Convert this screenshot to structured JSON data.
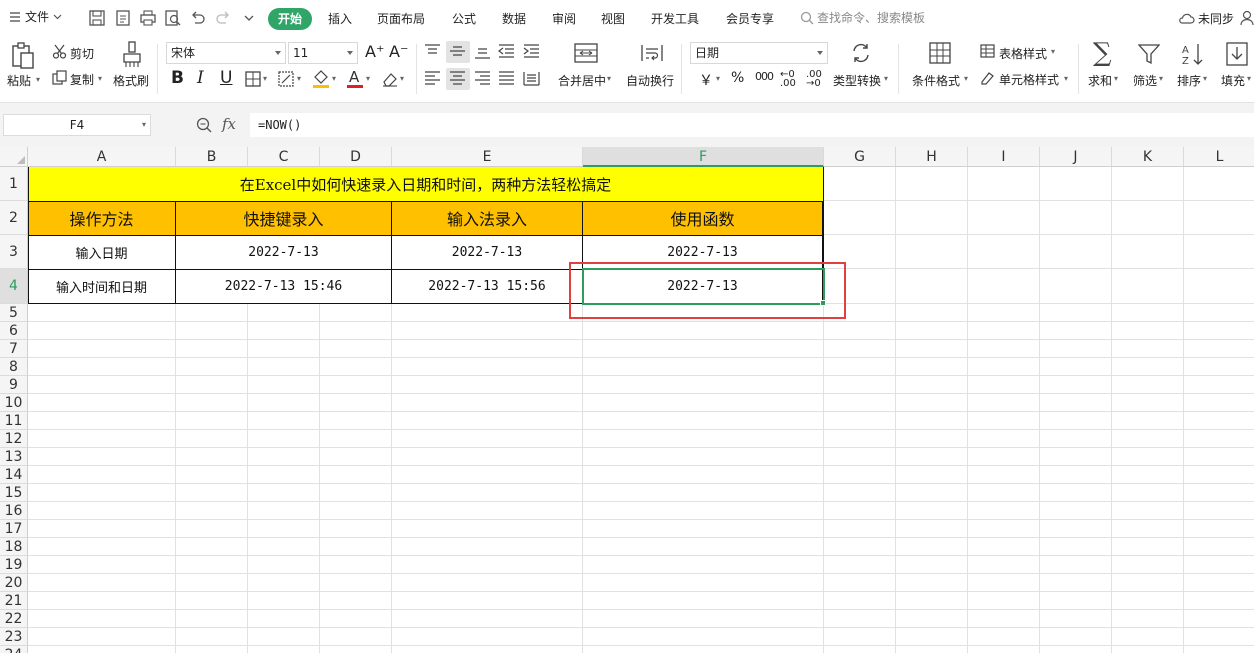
{
  "menu": {
    "file_label": "文件",
    "tabs": [
      "开始",
      "插入",
      "页面布局",
      "公式",
      "数据",
      "审阅",
      "视图",
      "开发工具",
      "会员专享"
    ],
    "search_placeholder": "查找命令、搜索模板",
    "sync_label": "未同步"
  },
  "ribbon": {
    "paste": "粘贴",
    "cut": "剪切",
    "copy": "复制",
    "format_painter": "格式刷",
    "font_name": "宋体",
    "font_size": "11",
    "merge_center": "合并居中",
    "wrap_text": "自动换行",
    "number_format": "日期",
    "currency_symbol": "￥",
    "percent_symbol": "%",
    "thousands_symbol": "000",
    "type_convert": "类型转换",
    "conditional_format": "条件格式",
    "table_style": "表格样式",
    "cell_style": "单元格样式",
    "sum": "求和",
    "filter": "筛选",
    "sort": "排序",
    "fill": "填充"
  },
  "formula_bar": {
    "name_box": "F4",
    "fx": "fx",
    "formula": "=NOW()"
  },
  "columns": [
    "A",
    "B",
    "C",
    "D",
    "E",
    "F",
    "G",
    "H",
    "I",
    "J",
    "K",
    "L"
  ],
  "rows": [
    "1",
    "2",
    "3",
    "4",
    "5",
    "6",
    "7",
    "8",
    "9",
    "10",
    "11",
    "12",
    "13",
    "14",
    "15",
    "16",
    "17",
    "18",
    "19",
    "20",
    "21",
    "22",
    "23",
    "24"
  ],
  "table": {
    "title": "在Excel中如何快速录入日期和时间，两种方法轻松搞定",
    "headers": [
      "操作方法",
      "快捷键录入",
      "输入法录入",
      "使用函数"
    ],
    "row1": [
      "输入日期",
      "2022-7-13",
      "2022-7-13",
      "2022-7-13"
    ],
    "row2": [
      "输入时间和日期",
      "2022-7-13 15:46",
      "2022-7-13 15:56",
      "2022-7-13"
    ]
  }
}
